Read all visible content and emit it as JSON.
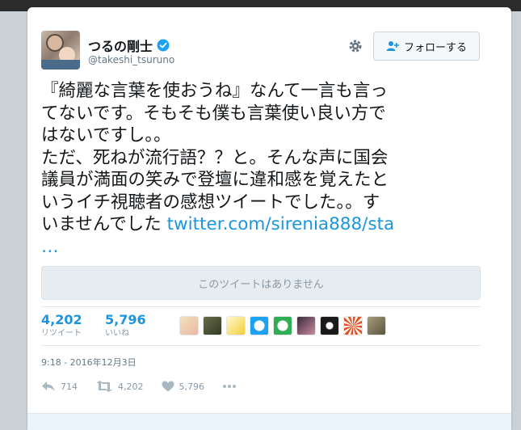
{
  "profile": {
    "name": "つるの剛士",
    "handle": "@takeshi_tsuruno"
  },
  "follow_button_label": "フォローする",
  "tweet": {
    "text": "『綺麗な言葉を使おうね』なんて一言も言ってないです。そもそも僕も言葉使い良い方ではないですし。。\nただ、死ねが流行語？？と。そんな声に国会議員が満面の笑みで登壇に違和感を覚えたというイチ視聴者の感想ツイートでした。。すいませんでした ",
    "link_text": "twitter.com/sirenia888/sta …"
  },
  "quoted_tweet_notice": "このツイートはありません",
  "stats": {
    "retweets": "4,202",
    "retweets_label": "リツイート",
    "likes": "5,796",
    "likes_label": "いいね"
  },
  "timestamp": "9:18 - 2016年12月3日",
  "actions": {
    "reply_count": "714",
    "retweet_count": "4,202",
    "like_count": "5,796"
  },
  "colors": {
    "accent": "#1b95e0",
    "verified": "#1da1f2",
    "muted": "#8899a6"
  },
  "icons": [
    "verified-badge-icon",
    "gear-icon",
    "follow-person-icon",
    "reply-icon",
    "retweet-icon",
    "heart-icon",
    "more-icon"
  ]
}
